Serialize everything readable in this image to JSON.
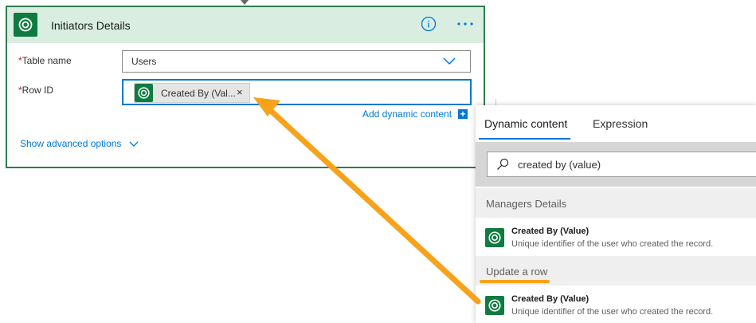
{
  "card": {
    "title": "Initiators Details",
    "info_icon": "info-icon",
    "more_icon": "more-options-icon",
    "app_icon": "dataverse-icon"
  },
  "fields": {
    "table_name": {
      "required_mark": "*",
      "label": "Table name",
      "value": "Users"
    },
    "row_id": {
      "required_mark": "*",
      "label": "Row ID",
      "token_label": "Created By (Val...",
      "token_close": "×"
    }
  },
  "add_dynamic_content": "Add dynamic content",
  "show_advanced_options": "Show advanced options",
  "panel": {
    "tabs": [
      {
        "label": "Dynamic content",
        "active": true
      },
      {
        "label": "Expression",
        "active": false
      }
    ],
    "search": {
      "value": "created by (value)"
    },
    "groups": [
      {
        "title": "Managers Details",
        "items": [
          {
            "title": "Created By (Value)",
            "description": "Unique identifier of the user who created the record."
          }
        ]
      },
      {
        "title": "Update a row",
        "items": [
          {
            "title": "Created By (Value)",
            "description": "Unique identifier of the user who created the record."
          }
        ]
      }
    ]
  },
  "colors": {
    "accent": "#0078d4",
    "card_border": "#2f7d4f",
    "header_bg": "#d9eee1",
    "app_icon_bg": "#0f7b41",
    "annotation_arrow": "#f7a21b"
  }
}
